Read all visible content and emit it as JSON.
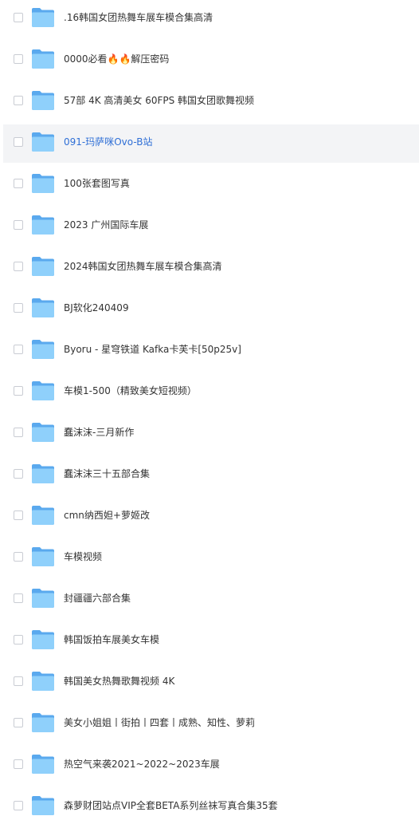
{
  "file_list": {
    "items": [
      {
        "name": ".16韩国女团热舞车展车模合集高清",
        "icon": "folder-icon"
      },
      {
        "name": "0000必看🔥🔥解压密码",
        "icon": "folder-icon"
      },
      {
        "name": "57部 4K 高清美女 60FPS  韩国女团歌舞视频",
        "icon": "folder-icon"
      },
      {
        "name": "091-玛萨咪Ovo-B站",
        "icon": "folder-icon",
        "state": "hovered"
      },
      {
        "name": "100张套图写真",
        "icon": "folder-icon"
      },
      {
        "name": "2023 广州国际车展",
        "icon": "folder-icon"
      },
      {
        "name": "2024韩国女团热舞车展车模合集高清",
        "icon": "folder-icon"
      },
      {
        "name": "BJ软化240409",
        "icon": "folder-icon"
      },
      {
        "name": "Byoru - 星穹铁道 Kafka卡芙卡[50p25v]",
        "icon": "folder-icon"
      },
      {
        "name": "车模1-500（精致美女短视频）",
        "icon": "folder-icon"
      },
      {
        "name": "蠢沫沫-三月新作",
        "icon": "folder-icon"
      },
      {
        "name": "蠢沫沫三十五部合集",
        "icon": "folder-icon"
      },
      {
        "name": "cmn纳西妲+萝姬改",
        "icon": "folder-icon"
      },
      {
        "name": "车模视频",
        "icon": "folder-icon"
      },
      {
        "name": "封疆疆六部合集",
        "icon": "folder-icon"
      },
      {
        "name": "韩国饭拍车展美女车模",
        "icon": "folder-icon"
      },
      {
        "name": "韩国美女热舞歌舞视频 4K",
        "icon": "folder-icon"
      },
      {
        "name": "美女小姐姐丨街拍丨四套丨成熟、知性、萝莉",
        "icon": "folder-icon"
      },
      {
        "name": "热空气来袭2021~2022~2023车展",
        "icon": "folder-icon"
      },
      {
        "name": "森萝财团站点VIP全套BETA系列丝袜写真合集35套",
        "icon": "folder-icon"
      }
    ]
  },
  "colors": {
    "folder_back": "#5aa9ee",
    "folder_front": "#8fd0fb",
    "hover_background": "#f3f4f6",
    "hover_text": "#2f6fd6",
    "text": "#333333"
  }
}
